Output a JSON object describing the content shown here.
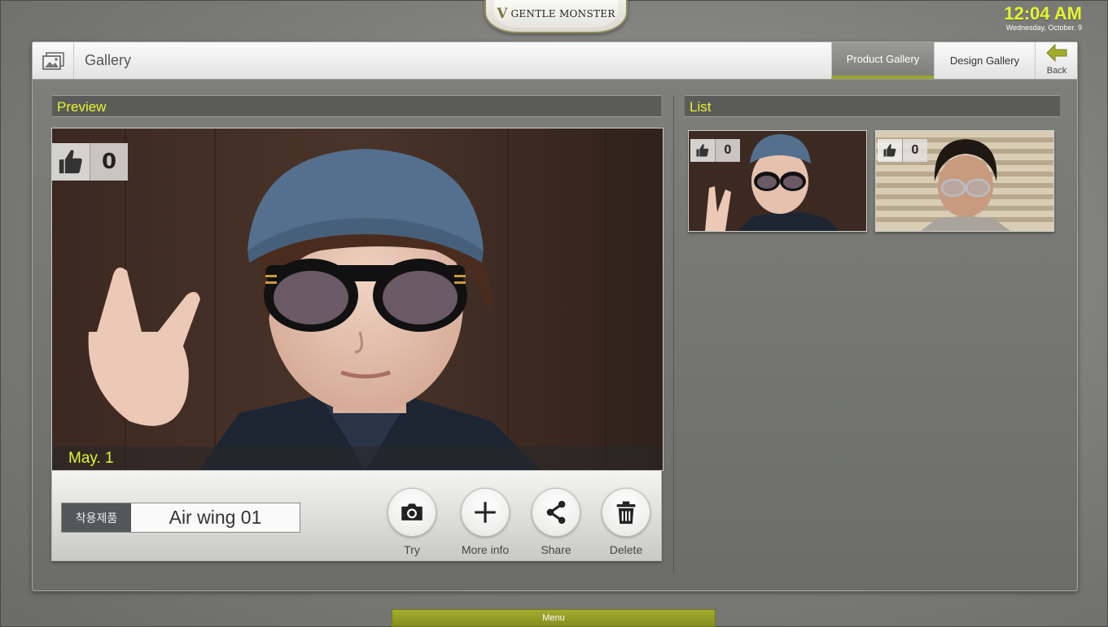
{
  "brand": {
    "logo_mark": "V",
    "name": "GENTLE MONSTER"
  },
  "clock": {
    "time": "12:04 AM",
    "date": "Wednesday, October. 9"
  },
  "header": {
    "title": "Gallery",
    "tabs": [
      {
        "label": "Product Gallery",
        "active": true
      },
      {
        "label": "Design Gallery",
        "active": false
      }
    ],
    "back_label": "Back"
  },
  "preview": {
    "title": "Preview",
    "likes": "0",
    "date": "May. 1",
    "product_label": "착용제품",
    "product_name": "Air wing 01",
    "actions": [
      {
        "label": "Try",
        "icon": "camera-icon"
      },
      {
        "label": "More info",
        "icon": "plus-icon"
      },
      {
        "label": "Share",
        "icon": "share-icon"
      },
      {
        "label": "Delete",
        "icon": "trash-icon"
      }
    ]
  },
  "list": {
    "title": "List",
    "items": [
      {
        "likes": "0"
      },
      {
        "likes": "0"
      }
    ]
  },
  "menu": {
    "label": "Menu"
  },
  "colors": {
    "accent": "#e5f52e",
    "menu_green": "#9aa52e",
    "panel": "#757672"
  }
}
